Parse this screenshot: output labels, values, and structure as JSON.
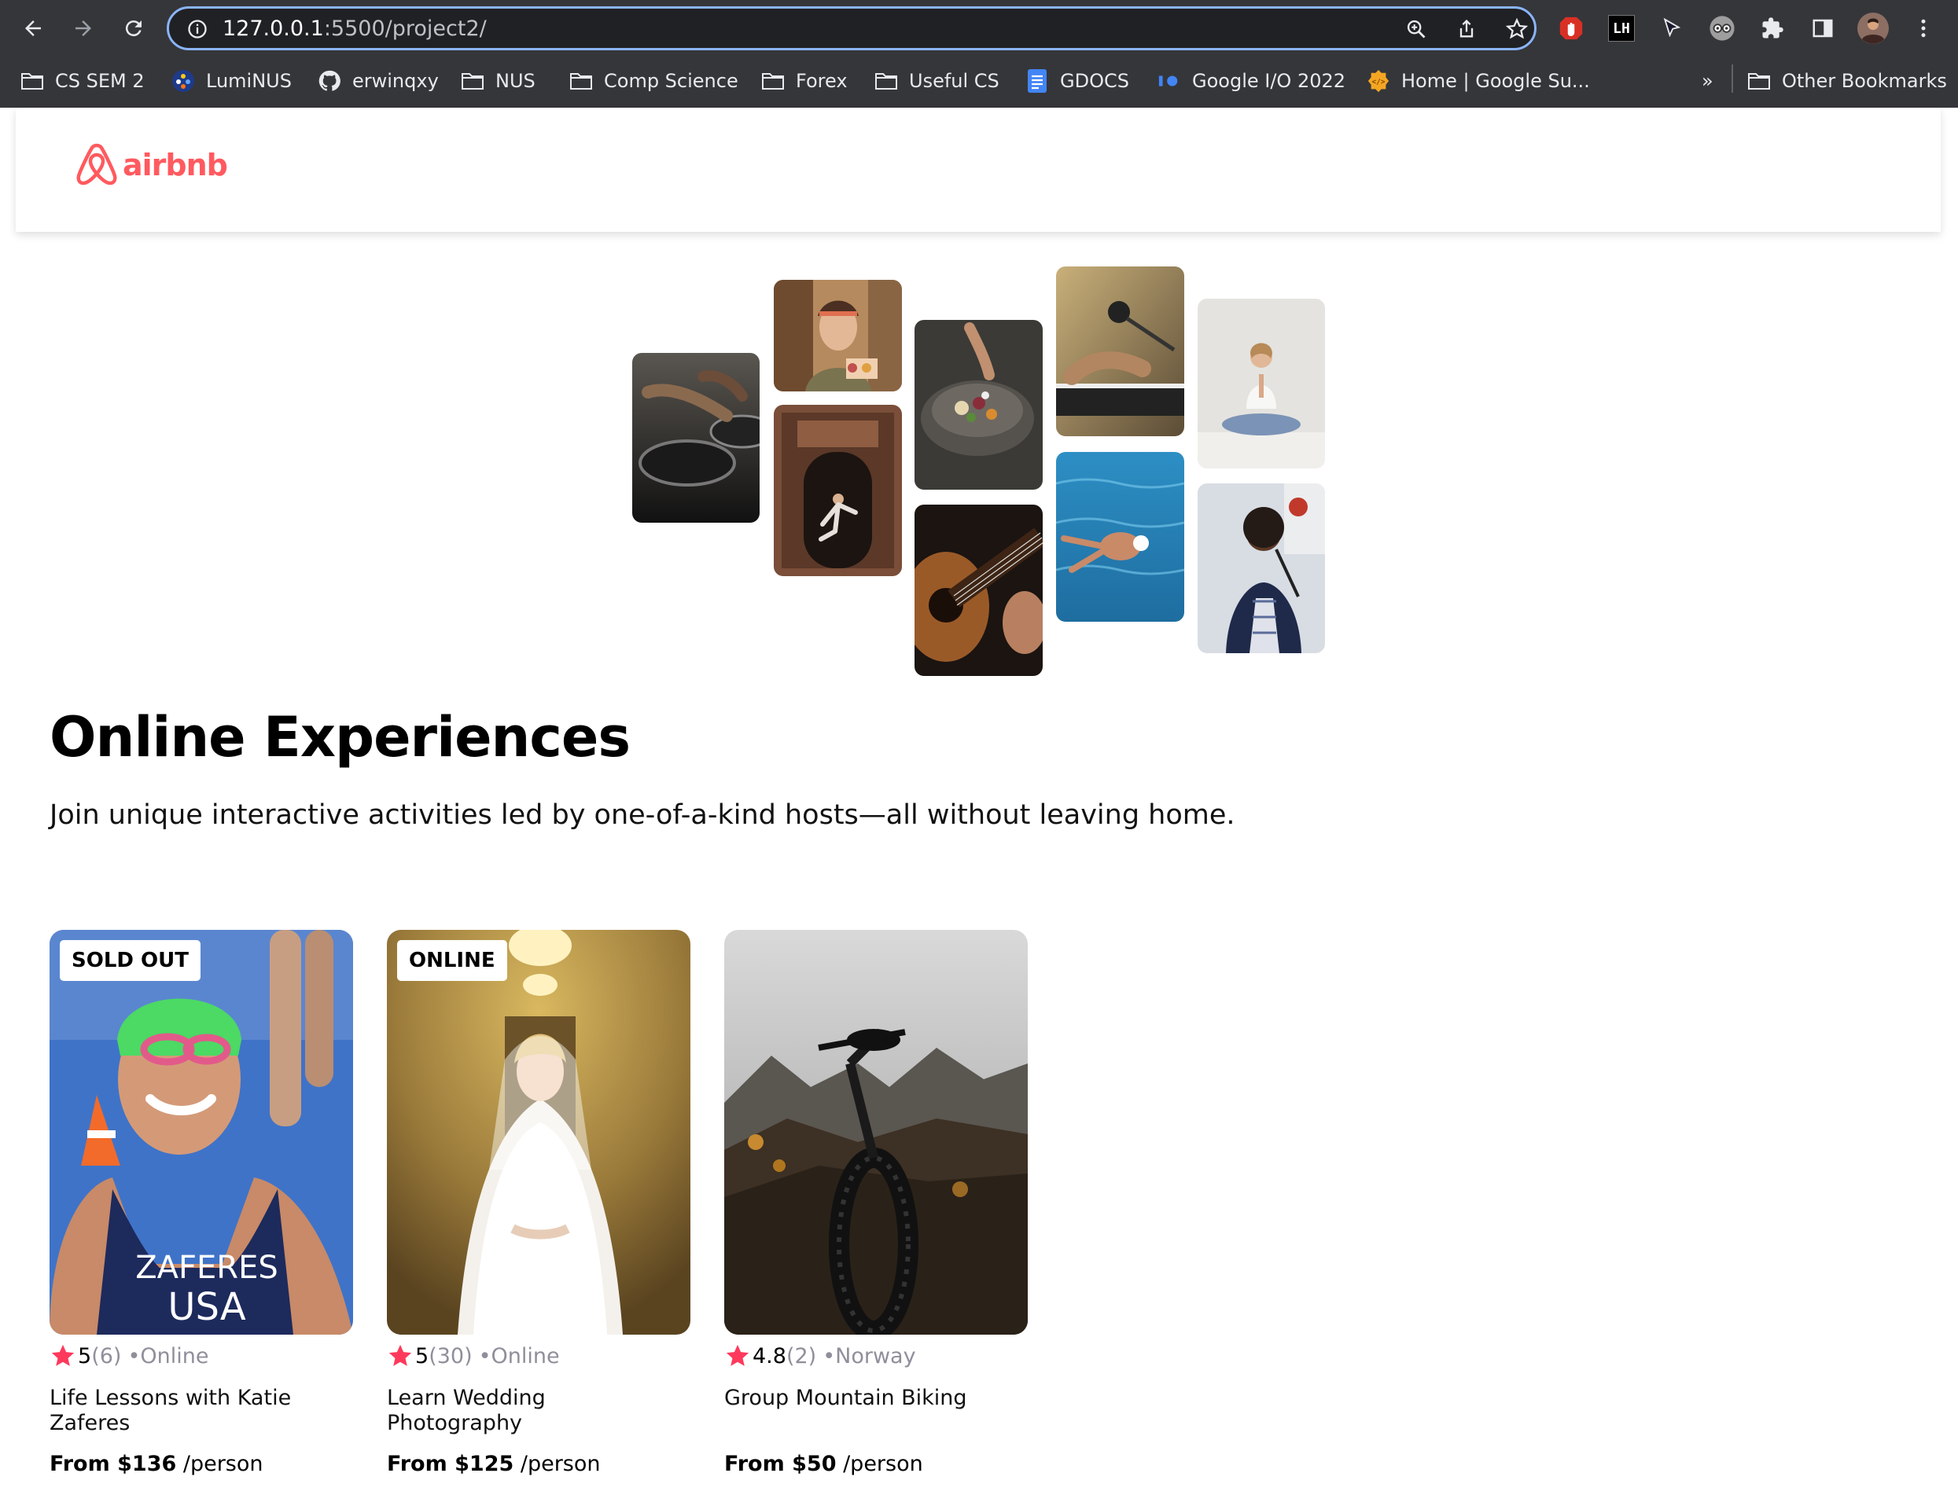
{
  "browser": {
    "url_host": "127.0.0.1",
    "url_path": ":5500/project2/",
    "bookmarks": [
      {
        "label": "CS SEM 2",
        "icon": "folder-icon"
      },
      {
        "label": "LumiNUS",
        "icon": "luminus-icon"
      },
      {
        "label": "erwinqxy",
        "icon": "github-icon"
      },
      {
        "label": "NUS",
        "icon": "folder-icon"
      },
      {
        "label": "Comp Science",
        "icon": "folder-icon"
      },
      {
        "label": "Forex",
        "icon": "folder-icon"
      },
      {
        "label": "Useful CS",
        "icon": "folder-icon"
      },
      {
        "label": "GDOCS",
        "icon": "gdocs-icon"
      },
      {
        "label": "Google I/O 2022",
        "icon": "google-io-icon"
      },
      {
        "label": "Home | Google Su...",
        "icon": "google-summit-icon"
      }
    ],
    "overflow_label": "»",
    "other_bookmarks": "Other Bookmarks",
    "extension_text": "LH"
  },
  "navbar": {
    "logo_text": "airbnb"
  },
  "hero": {
    "title": "Online Experiences",
    "subtitle": "Join unique interactive activities led by one-of-a-kind hosts—all without leaving home."
  },
  "cards": [
    {
      "badge": "SOLD OUT",
      "rating": "5",
      "review_count": "(6)",
      "location": "•Online",
      "title": "Life Lessons with Katie Zaferes",
      "price": "From $136",
      "per": "/person",
      "jersey": "ZAFERES",
      "jersey2": "USA"
    },
    {
      "badge": "ONLINE",
      "rating": "5",
      "review_count": "(30)",
      "location": "•Online",
      "title": "Learn Wedding Photography",
      "price": "From $125",
      "per": "/person"
    },
    {
      "badge": "",
      "rating": "4.8",
      "review_count": "(2)",
      "location": "•Norway",
      "title": "Group Mountain Biking",
      "price": "From $50",
      "per": "/person"
    }
  ],
  "colors": {
    "brand": "#ff5a5f",
    "muted": "#918e9b",
    "chrome_bg": "#35363a",
    "focus_ring": "#8ab4f8"
  }
}
